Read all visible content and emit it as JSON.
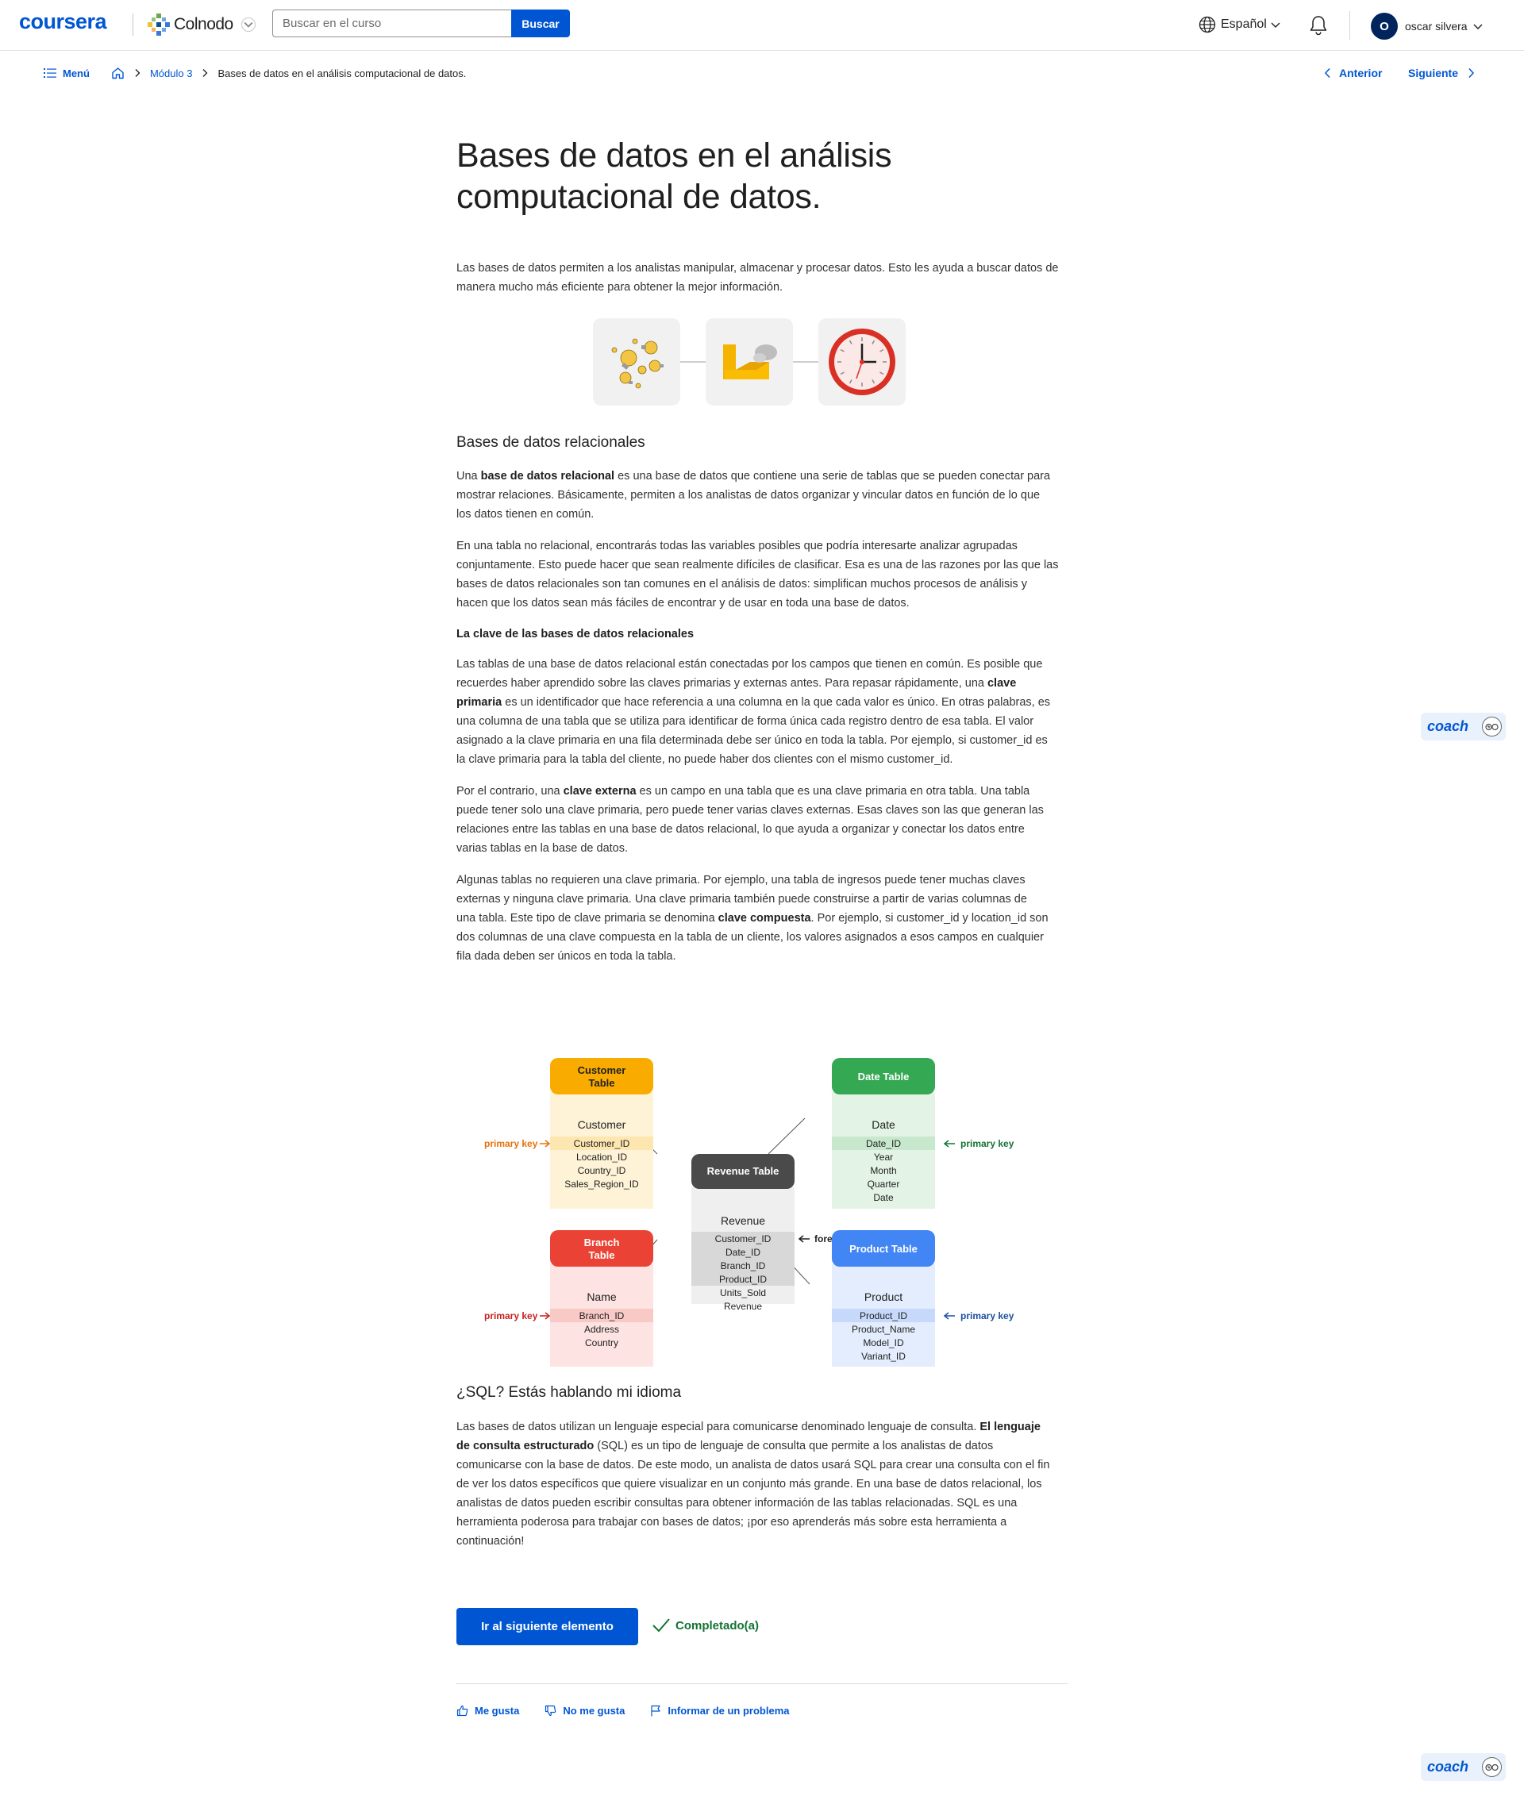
{
  "header": {
    "logo": "coursera",
    "partner": "Colnodo",
    "search_placeholder": "Buscar en el curso",
    "search_button": "Buscar",
    "language": "Español",
    "user_initial": "O",
    "user_name": "oscar silvera",
    "brand_color": "#0056d2"
  },
  "breadcrumb": {
    "menu": "Menú",
    "module": "Módulo 3",
    "current": "Bases de datos en el análisis computacional de datos.",
    "prev": "Anterior",
    "next": "Siguiente"
  },
  "article": {
    "title_line1": "Bases de datos en el análisis",
    "title_line2": "computacional de datos.",
    "intro_line1": "Las bases de datos permiten a los analistas manipular, almacenar y procesar datos. Esto les ayuda a buscar datos de",
    "intro_line2": "manera mucho más eficiente para obtener la mejor información.",
    "icons": [
      "lightbulbs-icon",
      "folder-icon",
      "clock-icon"
    ],
    "section1_title": "Bases de datos relacionales",
    "rel_p1": {
      "l1a": "Una ",
      "l1b": "base de datos relacional",
      "l1c": " es una base de datos que contiene una serie de tablas que se pueden conectar para",
      "l2": "mostrar relaciones. Básicamente, permiten a los analistas de datos organizar y vincular datos en función de lo que",
      "l3": "los datos tienen en común."
    },
    "rel_p2": {
      "l1": "En una tabla no relacional, encontrarás todas las variables posibles que podría interesarte analizar agrupadas",
      "l2": "conjuntamente. Esto puede hacer que sean realmente difíciles de clasificar. Esa es una de las razones por las que las",
      "l3": "bases de datos relacionales son tan comunes en el análisis de datos: simplifican muchos procesos de análisis y",
      "l4": "hacen que los datos sean más fáciles de encontrar y de usar en toda una base de datos."
    },
    "key_title": "La clave de las bases de datos relacionales",
    "key_p1": {
      "l1": "Las tablas de una base de datos relacional están conectadas por los campos que tienen en común. Es posible que",
      "l2a": "recuerdes haber aprendido sobre las claves primarias y externas antes. Para repasar rápidamente, una ",
      "l2b": "clave",
      "l3a": "primaria",
      "l3b": " es un identificador que hace referencia a una columna en la que cada valor es único. En otras palabras, es",
      "l4": "una columna de una tabla que se utiliza para identificar de forma única cada registro dentro de esa tabla. El valor",
      "l5": "asignado a la clave primaria en una fila determinada debe ser único en toda la tabla. Por ejemplo, si customer_id es",
      "l6": "la clave primaria para la tabla del cliente, no puede haber dos clientes con el mismo customer_id."
    },
    "key_p2": {
      "l1a": "Por el contrario, una ",
      "l1b": "clave externa",
      "l1c": " es un campo en una tabla que es una clave primaria en otra tabla. Una tabla",
      "l2": "puede tener solo una clave primaria, pero puede tener varias claves externas. Esas claves son las que generan las",
      "l3": "relaciones entre las tablas en una base de datos relacional, lo que ayuda a organizar y conectar los datos entre",
      "l4": "varias tablas en la base de datos."
    },
    "key_p3": {
      "l1": "Algunas tablas no requieren una clave primaria. Por ejemplo, una tabla de ingresos puede tener muchas claves",
      "l2": "externas y ninguna clave primaria. Una clave primaria también puede construirse a partir de varias columnas de",
      "l3a": "una tabla. Este tipo de clave primaria se denomina ",
      "l3b": "clave compuesta",
      "l3c": ". Por ejemplo, si customer_id y location_id son",
      "l4": "dos columnas de una clave compuesta en la tabla de un cliente, los valores asignados a esos campos en cualquier",
      "l5": "fila dada deben ser únicos en toda la tabla."
    },
    "section2_title": "¿SQL? Estás hablando mi idioma",
    "sql_p": {
      "l1a": "Las bases de datos utilizan un lenguaje especial para comunicarse denominado lenguaje de consulta. ",
      "l1b": "El lenguaje",
      "l2a": "de consulta estructurado",
      "l2b": " (SQL) es un tipo de lenguaje de consulta que permite a los analistas de datos",
      "l3": "comunicarse con la base de datos. De este modo, un analista de datos usará SQL para crear una consulta con el fin",
      "l4": "de ver los datos específicos que quiere visualizar en un conjunto más grande. En una base de datos relacional, los",
      "l5": "analistas de datos pueden escribir consultas para obtener información de las tablas relacionadas. SQL es una",
      "l6": "herramienta poderosa para trabajar con bases de datos; ¡por eso aprenderás más sobre esta herramienta a",
      "l7": "continuación!"
    },
    "next_button": "Ir al siguiente elemento",
    "completed": "Completado(a)",
    "like": "Me gusta",
    "dislike": "No me gusta",
    "report": "Informar de un problema"
  },
  "diagram": {
    "customer": {
      "title_l1": "Customer",
      "title_l2": "Table",
      "header": "Customer",
      "fields": [
        "Customer_ID",
        "Location_ID",
        "Country_ID",
        "Sales_Region_ID"
      ],
      "color": "#f9ab00",
      "body_color": "#fef3d6",
      "key_color": "#fde6b0"
    },
    "date": {
      "title": "Date Table",
      "header": "Date",
      "fields": [
        "Date_ID",
        "Year",
        "Month",
        "Quarter",
        "Date"
      ],
      "color": "#34a853",
      "body_color": "#e3f4e6",
      "key_color": "#c8e8ce"
    },
    "revenue": {
      "title": "Revenue Table",
      "header": "Revenue",
      "fields": [
        "Customer_ID",
        "Date_ID",
        "Branch_ID",
        "Product_ID",
        "Units_Sold",
        "Revenue"
      ],
      "color": "#4a4a4a",
      "body_color": "#efefef",
      "key_color": "#d8d8d8"
    },
    "branch": {
      "title_l1": "Branch",
      "title_l2": "Table",
      "header": "Name",
      "fields": [
        "Branch_ID",
        "Address",
        "Country"
      ],
      "color": "#ea4335",
      "body_color": "#fde3e1",
      "key_color": "#f8c9c5"
    },
    "product": {
      "title": "Product Table",
      "header": "Product",
      "fields": [
        "Product_ID",
        "Product_Name",
        "Model_ID",
        "Variant_ID"
      ],
      "color": "#4285f4",
      "body_color": "#e3edfd",
      "key_color": "#c6d9fb"
    },
    "label_primary": "primary key",
    "label_foreign": "foreign keys",
    "primary_colors": {
      "customer": "#e8710a",
      "date": "#137333",
      "branch": "#c5221f",
      "product": "#1a4fa0"
    }
  },
  "coach": {
    "label": "coach"
  }
}
